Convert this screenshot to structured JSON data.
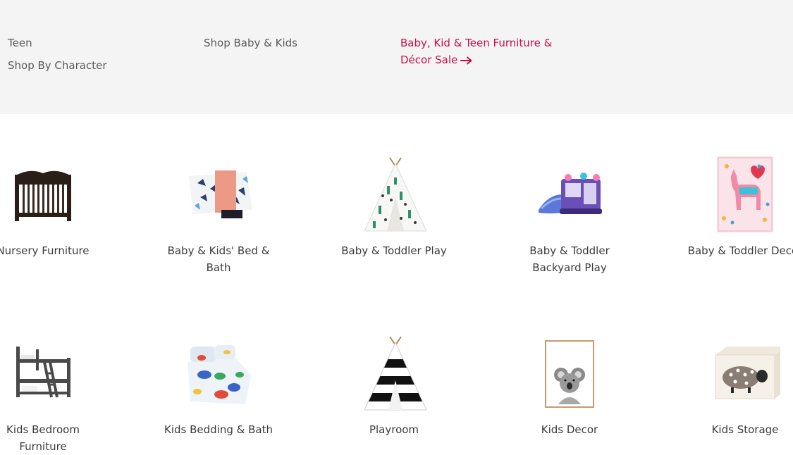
{
  "nav": {
    "links_col1": [
      "Teen",
      "Shop By Character"
    ],
    "links_col2": [
      "Shop Baby & Kids"
    ],
    "sale_link": "Baby, Kid & Teen Furniture & Décor Sale",
    "sale_color": "#c7104a",
    "arrow_icon": "arrow-right-icon"
  },
  "categories": [
    {
      "label": "Nursery Furniture",
      "icon": "crib-image"
    },
    {
      "label": "Baby & Kids' Bed & Bath",
      "icon": "blanket-image"
    },
    {
      "label": "Baby & Toddler Play",
      "icon": "teepee-cactus-image"
    },
    {
      "label": "Baby & Toddler Backyard Play",
      "icon": "bounce-house-image"
    },
    {
      "label": "Baby & Toddler Decor",
      "icon": "llama-art-image"
    },
    {
      "label": "Kids Bedroom Furniture",
      "icon": "bunk-bed-image"
    },
    {
      "label": "Kids Bedding & Bath",
      "icon": "dinosaur-bedding-image"
    },
    {
      "label": "Playroom",
      "icon": "striped-teepee-image"
    },
    {
      "label": "Kids Decor",
      "icon": "koala-print-image"
    },
    {
      "label": "Kids Storage",
      "icon": "sheep-toy-chest-image"
    }
  ]
}
